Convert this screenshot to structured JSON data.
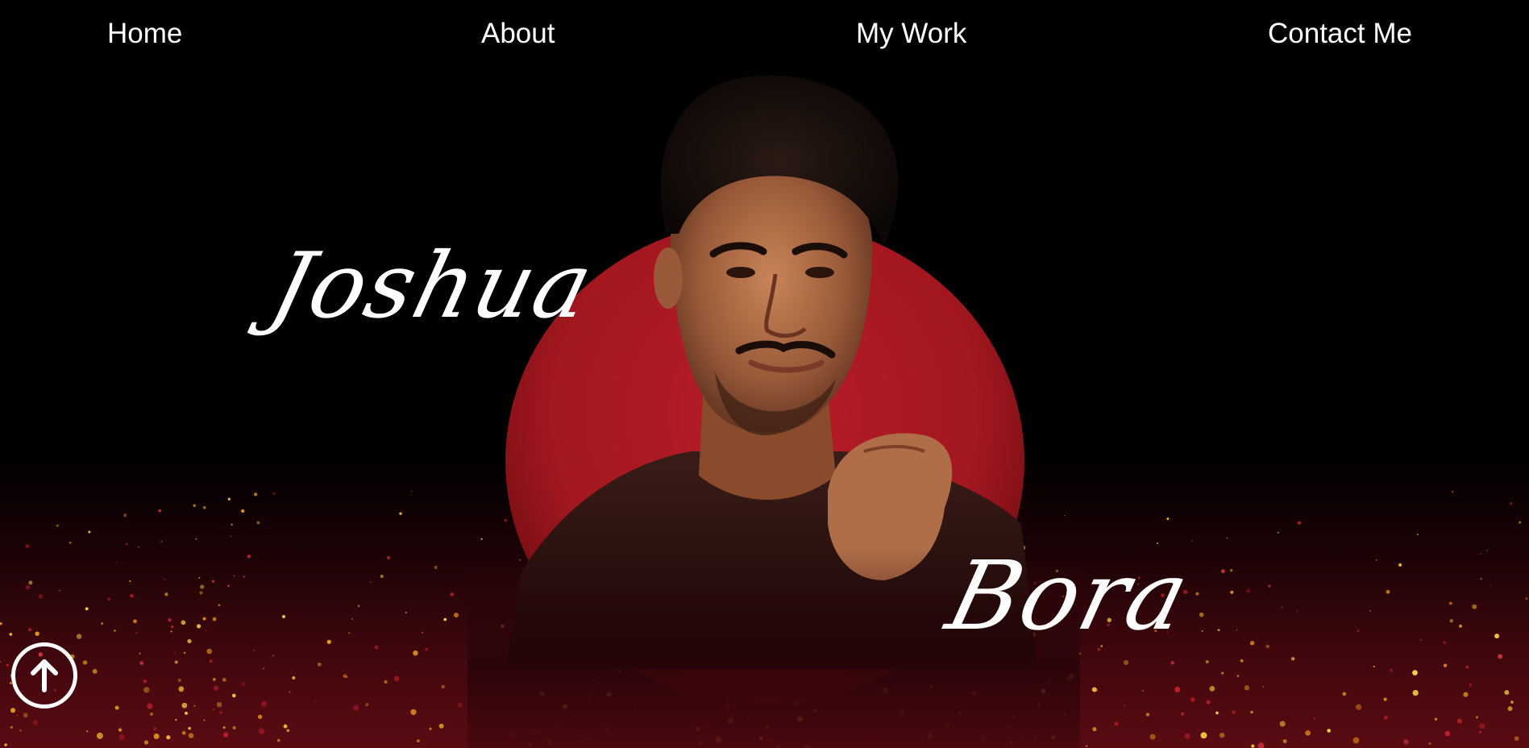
{
  "nav": {
    "home": "Home",
    "about": "About",
    "work": "My Work",
    "contact": "Contact Me"
  },
  "hero": {
    "first_name": "Joshua",
    "last_name": "Bora"
  },
  "icons": {
    "scroll_top": "arrow-up-icon"
  },
  "colors": {
    "background": "#000000",
    "accent_red": "#a3171f",
    "sparkle_gold": "#f0b020",
    "text": "#ffffff"
  }
}
